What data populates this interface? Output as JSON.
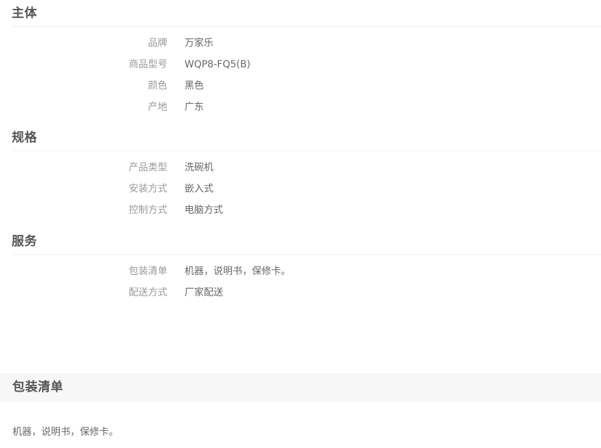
{
  "sections": [
    {
      "title": "主体",
      "rows": [
        {
          "label": "品牌",
          "value": "万家乐"
        },
        {
          "label": "商品型号",
          "value": "WQP8-FQ5(B)"
        },
        {
          "label": "颜色",
          "value": "黑色"
        },
        {
          "label": "产地",
          "value": "广东"
        }
      ]
    },
    {
      "title": "规格",
      "rows": [
        {
          "label": "产品类型",
          "value": "洗碗机"
        },
        {
          "label": "安装方式",
          "value": "嵌入式"
        },
        {
          "label": "控制方式",
          "value": "电脑方式"
        }
      ]
    },
    {
      "title": "服务",
      "rows": [
        {
          "label": "包装清单",
          "value": "机器，说明书，保修卡。"
        },
        {
          "label": "配送方式",
          "value": "厂家配送"
        }
      ]
    }
  ],
  "package_list": {
    "title": "包装清单",
    "content": "机器，说明书，保修卡。"
  }
}
